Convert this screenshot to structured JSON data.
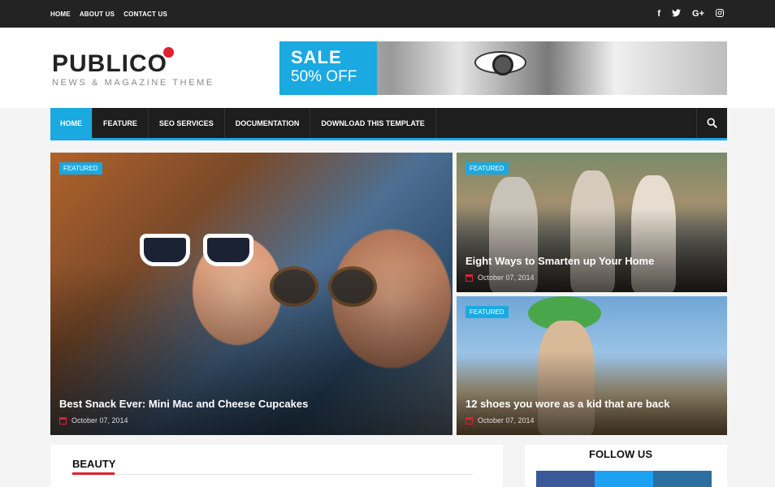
{
  "topbar": {
    "links": [
      "HOME",
      "ABOUT US",
      "CONTACT US"
    ],
    "social": [
      "f",
      "t",
      "G+",
      "ig"
    ]
  },
  "logo": {
    "name": "PUBLICO",
    "tagline": "NEWS & MAGAZINE THEME"
  },
  "banner": {
    "line1": "SALE",
    "line2": "50% OFF"
  },
  "nav": {
    "items": [
      "HOME",
      "FEATURE",
      "SEO SERVICES",
      "DOCUMENTATION",
      "DOWNLOAD THIS TEMPLATE"
    ],
    "active": "HOME"
  },
  "featured": [
    {
      "badge": "FEATURED",
      "title": "Best Snack Ever: Mini Mac and Cheese Cupcakes",
      "date": "October 07, 2014"
    },
    {
      "badge": "FEATURED",
      "title": "Eight Ways to Smarten up Your Home",
      "date": "October 07, 2014"
    },
    {
      "badge": "FEATURED",
      "title": "12 shoes you wore as a kid that are back",
      "date": "October 07, 2014"
    }
  ],
  "sections": {
    "beauty": "BEAUTY",
    "follow": "FOLLOW US"
  },
  "colors": {
    "accent": "#1aa9e1",
    "red": "#e0202c",
    "dark": "#1e1e1e",
    "facebook": "#3b5998",
    "twitter": "#1da1f2",
    "linkedin": "#2a6fa0"
  }
}
